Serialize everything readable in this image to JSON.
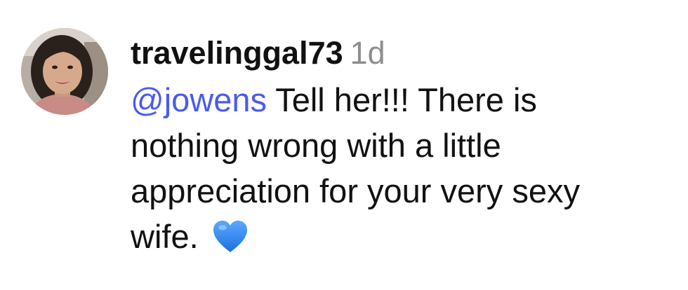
{
  "comment": {
    "username": "travelinggal73",
    "timestamp": "1d",
    "mention": "@jowens",
    "text_line1": " Tell her!!! There is",
    "text_line2": "nothing wrong with a little",
    "text_line3": "appreciation for your very sexy",
    "text_line4": "wife. ",
    "emoji": "blue-heart-icon"
  },
  "colors": {
    "mention": "#4a5af0",
    "timestamp": "#8e8e8e",
    "text": "#111111",
    "heart": "#2f8cff"
  }
}
